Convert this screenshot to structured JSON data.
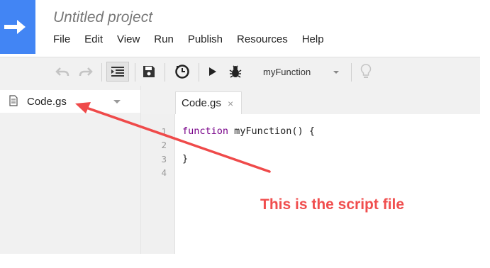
{
  "app": {
    "title": "Untitled project"
  },
  "menu": {
    "items": [
      "File",
      "Edit",
      "View",
      "Run",
      "Publish",
      "Resources",
      "Help"
    ]
  },
  "toolbar": {
    "function_select": "myFunction"
  },
  "sidebar": {
    "file_name": "Code.gs"
  },
  "editor": {
    "tab_label": "Code.gs",
    "tab_close": "×",
    "line_numbers": [
      "1",
      "2",
      "3",
      "4"
    ],
    "code_keyword": "function",
    "code_line1_rest": " myFunction() {",
    "code_line3": "}"
  },
  "annotation": {
    "text": "This is the script file",
    "color": "#f04e4e"
  },
  "colors": {
    "logo": "#4285f4",
    "keyword": "#770088"
  }
}
